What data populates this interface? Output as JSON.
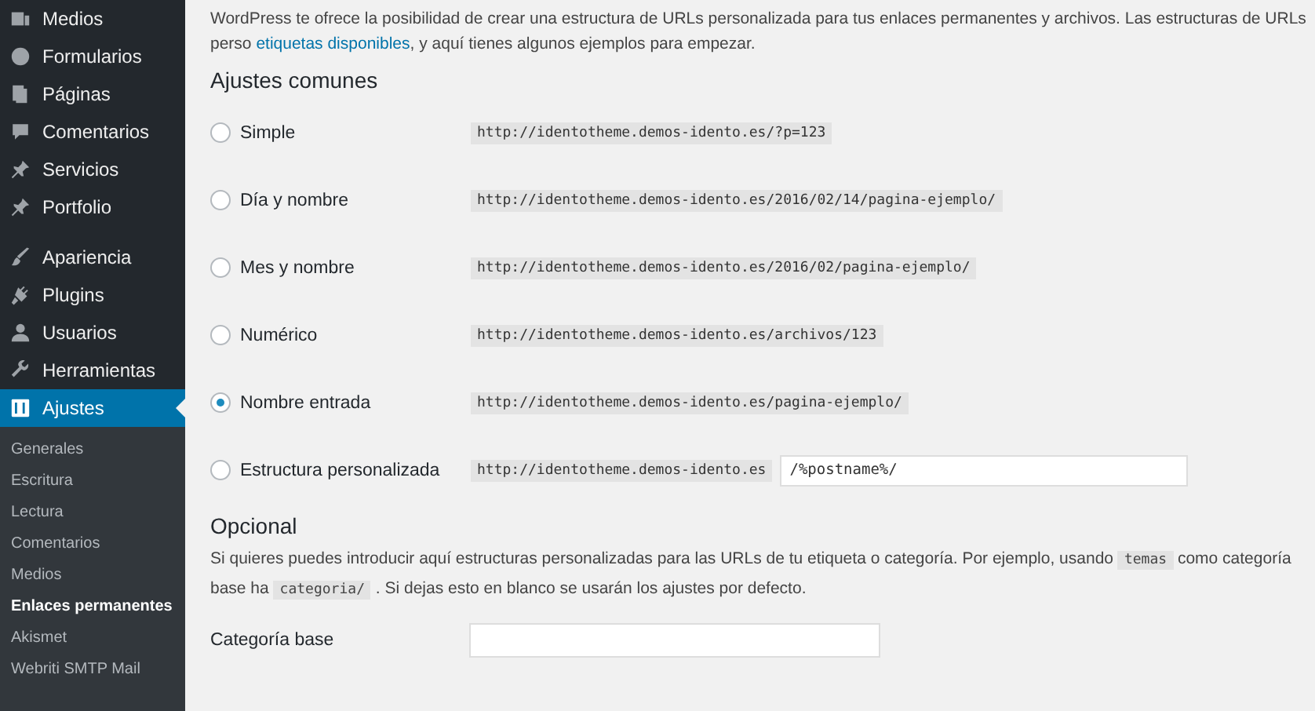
{
  "sidebar": {
    "items": [
      {
        "label": "Medios",
        "selected": false
      },
      {
        "label": "Formularios",
        "selected": false
      },
      {
        "label": "Páginas",
        "selected": false
      },
      {
        "label": "Comentarios",
        "selected": false
      },
      {
        "label": "Servicios",
        "selected": false
      },
      {
        "label": "Portfolio",
        "selected": false
      },
      {
        "label": "Apariencia",
        "selected": false
      },
      {
        "label": "Plugins",
        "selected": false
      },
      {
        "label": "Usuarios",
        "selected": false
      },
      {
        "label": "Herramientas",
        "selected": false
      },
      {
        "label": "Ajustes",
        "selected": true
      }
    ],
    "submenu": [
      {
        "label": "Generales",
        "selected": false
      },
      {
        "label": "Escritura",
        "selected": false
      },
      {
        "label": "Lectura",
        "selected": false
      },
      {
        "label": "Comentarios",
        "selected": false
      },
      {
        "label": "Medios",
        "selected": false
      },
      {
        "label": "Enlaces permanentes",
        "selected": true
      },
      {
        "label": "Akismet",
        "selected": false
      },
      {
        "label": "Webriti SMTP Mail",
        "selected": false
      }
    ]
  },
  "intro": {
    "text": "WordPress te ofrece la posibilidad de crear una estructura de URLs personalizada para tus enlaces permanentes y archivos. Las estructuras de URLs perso",
    "link": "etiquetas disponibles",
    "rest": ", y aquí tienes algunos ejemplos para empezar."
  },
  "common": {
    "heading": "Ajustes comunes",
    "options": [
      {
        "label": "Simple",
        "url": "http://identotheme.demos-idento.es/?p=123",
        "selected": false
      },
      {
        "label": "Día y nombre",
        "url": "http://identotheme.demos-idento.es/2016/02/14/pagina-ejemplo/",
        "selected": false
      },
      {
        "label": "Mes y nombre",
        "url": "http://identotheme.demos-idento.es/2016/02/pagina-ejemplo/",
        "selected": false
      },
      {
        "label": "Numérico",
        "url": "http://identotheme.demos-idento.es/archivos/123",
        "selected": false
      },
      {
        "label": "Nombre entrada",
        "url": "http://identotheme.demos-idento.es/pagina-ejemplo/",
        "selected": true
      },
      {
        "label": "Estructura personalizada",
        "url": "http://identotheme.demos-idento.es",
        "selected": false,
        "value": "/%postname%/"
      }
    ]
  },
  "optional": {
    "heading": "Opcional",
    "segments": [
      {
        "kind": "text",
        "text": "Si quieres puedes introducir aquí estructuras personalizadas para las URLs de tu etiqueta o categoría. Por ejemplo, usando"
      },
      {
        "kind": "code",
        "text": "temas"
      },
      {
        "kind": "text",
        "text": "como categoría base ha"
      },
      {
        "kind": "code",
        "text": "categoria/"
      },
      {
        "kind": "text",
        "text": ". Si dejas esto en blanco se usarán los ajustes por defecto."
      }
    ],
    "field_label": "Categoría base"
  }
}
